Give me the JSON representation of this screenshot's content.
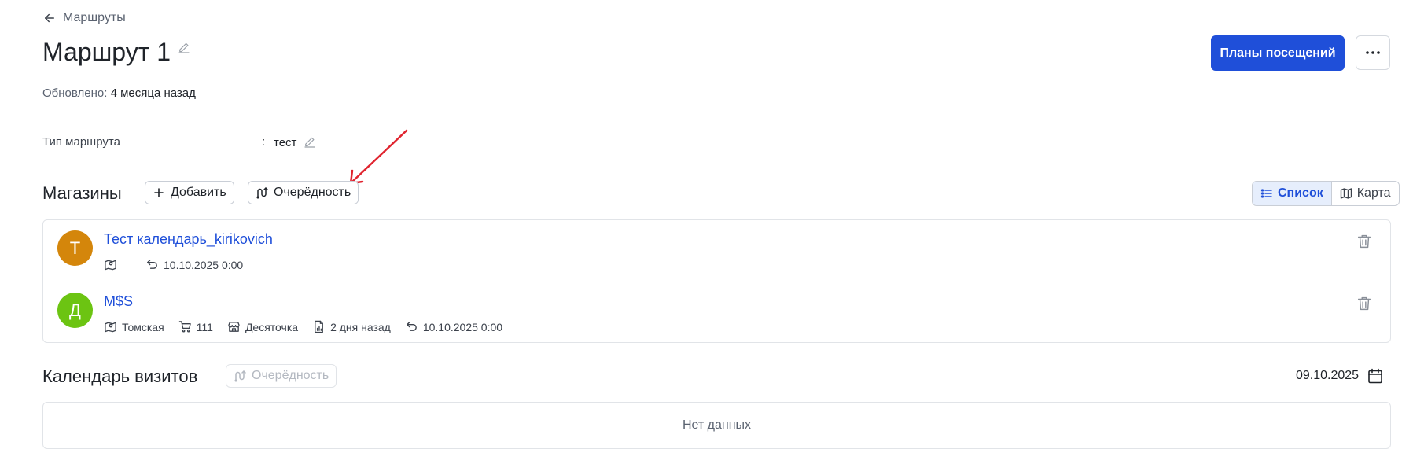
{
  "breadcrumb": {
    "back_label": "Маршруты"
  },
  "header": {
    "title": "Маршрут 1",
    "updated_label": "Обновлено:",
    "updated_value": "4 месяца назад",
    "primary_button": "Планы посещений",
    "more_button": "···"
  },
  "fields": {
    "route_type_label": "Тип маршрута",
    "colon": ":",
    "route_type_value": "тест"
  },
  "stores_section": {
    "title": "Магазины",
    "add_button": "Добавить",
    "order_button": "Очерёдность",
    "view_list": "Список",
    "view_map": "Карта",
    "items": [
      {
        "avatar_letter": "Т",
        "avatar_color": "#d4860b",
        "name": "Тест календарь_kirikovich",
        "date": "10.10.2025 0:00"
      },
      {
        "avatar_letter": "Д",
        "avatar_color": "#6cc412",
        "name": "M$S",
        "region": "Томская",
        "cart_count": "111",
        "chain": "Десяточка",
        "report": "2 дня назад",
        "date": "10.10.2025 0:00"
      }
    ]
  },
  "calendar_section": {
    "title": "Календарь визитов",
    "order_button": "Очерёдность",
    "date": "09.10.2025",
    "empty_text": "Нет данных"
  },
  "colors": {
    "primary": "#1f4fd9",
    "annotation_arrow": "#e0242f"
  }
}
